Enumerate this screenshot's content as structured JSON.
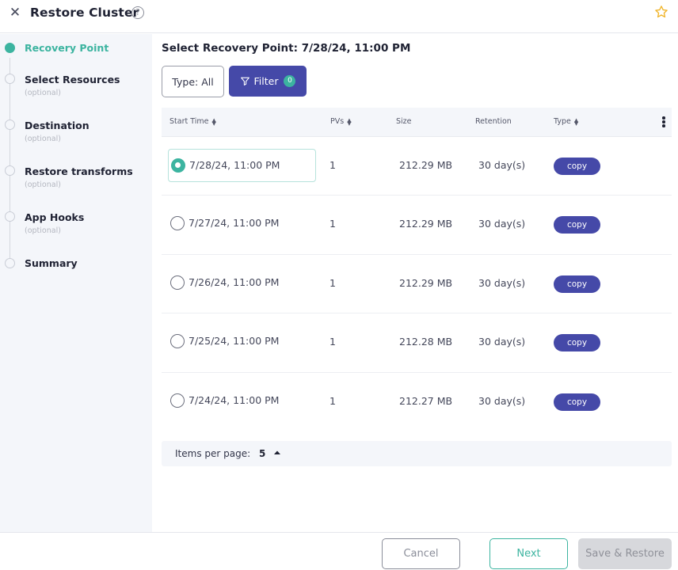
{
  "header": {
    "title": "Restore Cluster",
    "close_icon": "close-icon",
    "help_icon": "help-icon",
    "help_glyph": "?",
    "favorite_icon": "star-icon",
    "favorite_color": "#f0b429"
  },
  "sidebar": {
    "steps": [
      {
        "label": "Recovery Point",
        "sub": "",
        "active": true
      },
      {
        "label": "Select Resources",
        "sub": "(optional)",
        "active": false
      },
      {
        "label": "Destination",
        "sub": "(optional)",
        "active": false
      },
      {
        "label": "Restore transforms",
        "sub": "(optional)",
        "active": false
      },
      {
        "label": "App Hooks",
        "sub": "(optional)",
        "active": false
      },
      {
        "label": "Summary",
        "sub": "",
        "active": false
      }
    ]
  },
  "main": {
    "title": "Select Recovery Point: 7/28/24, 11:00 PM",
    "type_button": "Type: All",
    "filter_button": "Filter",
    "filter_count": "0",
    "table": {
      "columns": [
        "Start Time",
        "PVs",
        "Size",
        "Retention",
        "Type"
      ],
      "rows": [
        {
          "start_time": "7/28/24, 11:00 PM",
          "pvs": "1",
          "size": "212.29 MB",
          "retention": "30 day(s)",
          "type": "copy",
          "selected": true
        },
        {
          "start_time": "7/27/24, 11:00 PM",
          "pvs": "1",
          "size": "212.29 MB",
          "retention": "30 day(s)",
          "type": "copy",
          "selected": false
        },
        {
          "start_time": "7/26/24, 11:00 PM",
          "pvs": "1",
          "size": "212.29 MB",
          "retention": "30 day(s)",
          "type": "copy",
          "selected": false
        },
        {
          "start_time": "7/25/24, 11:00 PM",
          "pvs": "1",
          "size": "212.28 MB",
          "retention": "30 day(s)",
          "type": "copy",
          "selected": false
        },
        {
          "start_time": "7/24/24, 11:00 PM",
          "pvs": "1",
          "size": "212.27 MB",
          "retention": "30 day(s)",
          "type": "copy",
          "selected": false
        }
      ]
    },
    "pager": {
      "label": "Items per page:",
      "value": "5"
    }
  },
  "footer": {
    "cancel": "Cancel",
    "next": "Next",
    "save": "Save & Restore"
  },
  "colors": {
    "accent_teal": "#3cb4a0",
    "accent_indigo": "#4549a8",
    "sidebar_bg": "#f4f6fa"
  }
}
